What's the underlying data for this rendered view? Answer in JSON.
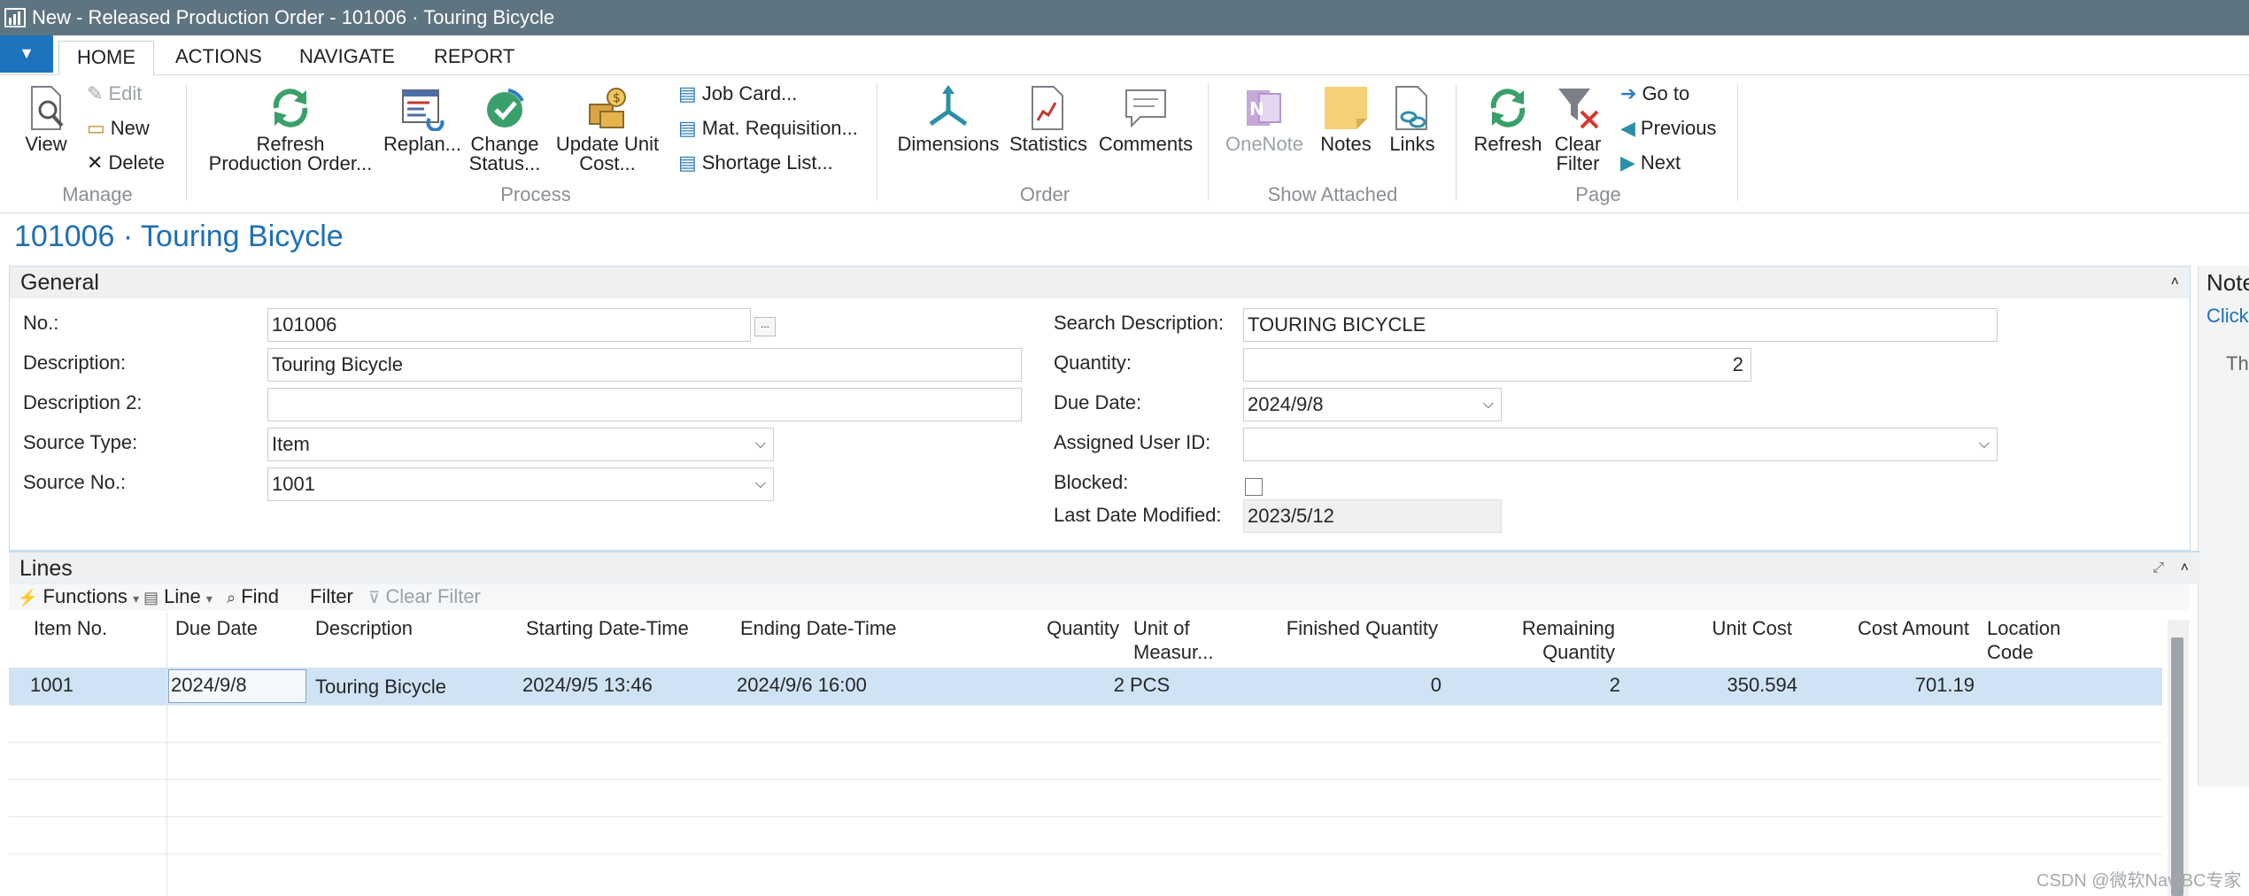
{
  "window": {
    "title": "New - Released Production Order - 101006 · Touring Bicycle"
  },
  "tabs": [
    {
      "label": "HOME"
    },
    {
      "label": "ACTIONS"
    },
    {
      "label": "NAVIGATE"
    },
    {
      "label": "REPORT"
    }
  ],
  "ribbon": {
    "manage": {
      "view": "View",
      "edit": "Edit",
      "new": "New",
      "delete": "Delete",
      "label": "Manage"
    },
    "process": {
      "refresh_line1": "Refresh",
      "refresh_line2": "Production Order...",
      "replan": "Replan...",
      "change_line1": "Change",
      "change_line2": "Status...",
      "update_line1": "Update Unit",
      "update_line2": "Cost...",
      "job_card": "Job Card...",
      "mat_req": "Mat. Requisition...",
      "shortage": "Shortage List...",
      "label": "Process"
    },
    "order": {
      "dimensions": "Dimensions",
      "statistics": "Statistics",
      "comments": "Comments",
      "label": "Order"
    },
    "show_attached": {
      "onenote": "OneNote",
      "notes": "Notes",
      "links": "Links",
      "label": "Show Attached"
    },
    "page": {
      "refresh": "Refresh",
      "clear_line1": "Clear",
      "clear_line2": "Filter",
      "goto": "Go to",
      "previous": "Previous",
      "next": "Next",
      "label": "Page"
    }
  },
  "page_title": "101006 · Touring Bicycle",
  "general": {
    "header": "General",
    "no_label": "No.:",
    "no_value": "101006",
    "assist_btn": "...",
    "description_label": "Description:",
    "description_value": "Touring Bicycle",
    "description2_label": "Description 2:",
    "description2_value": "",
    "source_type_label": "Source Type:",
    "source_type_value": "Item",
    "source_no_label": "Source No.:",
    "source_no_value": "1001",
    "search_desc_label": "Search Description:",
    "search_desc_value": "TOURING BICYCLE",
    "quantity_label": "Quantity:",
    "quantity_value": "2",
    "due_date_label": "Due Date:",
    "due_date_value": "2024/9/8",
    "assigned_user_label": "Assigned User ID:",
    "assigned_user_value": "",
    "blocked_label": "Blocked:",
    "last_modified_label": "Last Date Modified:",
    "last_modified_value": "2023/5/12"
  },
  "notes_pane": {
    "header": "Note",
    "link": "Click",
    "text": "Th"
  },
  "lines": {
    "header": "Lines",
    "toolbar": {
      "functions": "Functions",
      "line": "Line",
      "find": "Find",
      "filter": "Filter",
      "clear_filter": "Clear Filter"
    },
    "columns": [
      {
        "l1": "Item No.",
        "l2": ""
      },
      {
        "l1": "Due Date",
        "l2": ""
      },
      {
        "l1": "Description",
        "l2": ""
      },
      {
        "l1": "Starting Date-Time",
        "l2": ""
      },
      {
        "l1": "Ending Date-Time",
        "l2": ""
      },
      {
        "l1": "Quantity",
        "l2": ""
      },
      {
        "l1": "Unit of",
        "l2": "Measur..."
      },
      {
        "l1": "Finished Quantity",
        "l2": ""
      },
      {
        "l1": "Remaining",
        "l2": "Quantity"
      },
      {
        "l1": "Unit Cost",
        "l2": ""
      },
      {
        "l1": "Cost Amount",
        "l2": ""
      },
      {
        "l1": "Location",
        "l2": "Code"
      }
    ],
    "rows": [
      {
        "item_no": "1001",
        "due_date": "2024/9/8",
        "description": "Touring Bicycle",
        "start": "2024/9/5 13:46",
        "end": "2024/9/6 16:00",
        "quantity": "2",
        "uom": "PCS",
        "finished": "0",
        "remaining": "2",
        "unit_cost": "350.594",
        "cost_amount": "701.19",
        "location": ""
      }
    ]
  },
  "watermark": "CSDN @微软Nav/BC专家",
  "colors": {
    "titlebar": "#5f7481",
    "accent": "#1e73be",
    "selected_row": "#cfe3f5",
    "section": "#eef0f2"
  }
}
